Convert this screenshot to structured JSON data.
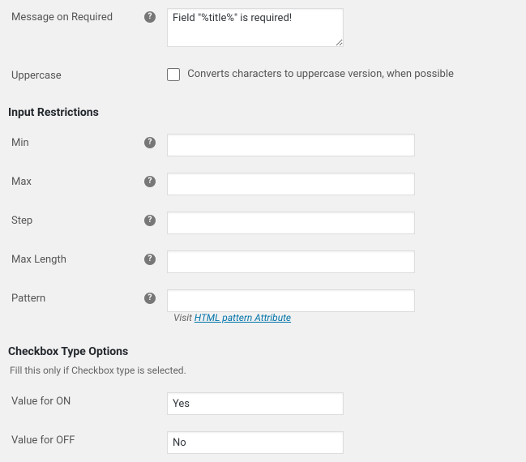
{
  "fields": {
    "message_required": {
      "label": "Message on Required",
      "value": "Field \"%title%\" is required!"
    },
    "uppercase": {
      "label": "Uppercase",
      "desc": "Converts characters to uppercase version, when possible"
    }
  },
  "sections": {
    "input_restrictions": {
      "title": "Input Restrictions"
    },
    "checkbox_options": {
      "title": "Checkbox Type Options",
      "desc": "Fill this only if Checkbox type is selected."
    }
  },
  "restrictions": {
    "min": {
      "label": "Min",
      "value": ""
    },
    "max": {
      "label": "Max",
      "value": ""
    },
    "step": {
      "label": "Step",
      "value": ""
    },
    "max_length": {
      "label": "Max Length",
      "value": ""
    },
    "pattern": {
      "label": "Pattern",
      "value": "",
      "note_prefix": "Visit ",
      "note_link": "HTML pattern Attribute"
    }
  },
  "checkbox": {
    "on": {
      "label": "Value for ON",
      "value": "Yes"
    },
    "off": {
      "label": "Value for OFF",
      "value": "No"
    }
  }
}
